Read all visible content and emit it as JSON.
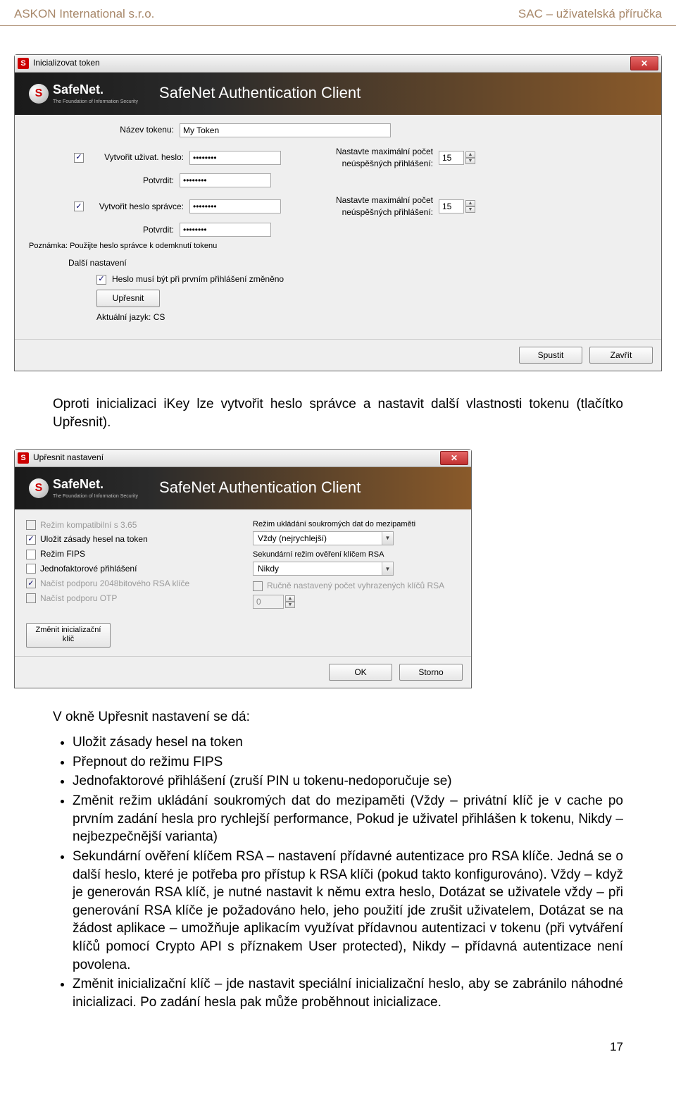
{
  "header": {
    "left": "ASKON International s.r.o.",
    "right": "SAC – uživatelská příručka"
  },
  "dialog1": {
    "title": "Inicializovat token",
    "banner_brand": "SafeNet.",
    "banner_sub": "The Foundation of Information Security",
    "banner_title": "SafeNet Authentication Client",
    "r_token_label": "Název tokenu:",
    "r_token_value": "My Token",
    "chk_user_pw": "Vytvořit uživat. heslo:",
    "user_pw": "••••••••",
    "user_pw_confirm_label": "Potvrdit:",
    "user_pw_confirm": "••••••••",
    "max_fail_label": "Nastavte maximální počet neúspěšných přihlášení:",
    "max_fail_value": "15",
    "chk_admin_pw": "Vytvořit heslo správce:",
    "admin_pw": "••••••••",
    "admin_pw_confirm_label": "Potvrdit:",
    "admin_pw_confirm": "••••••••",
    "max_fail_value2": "15",
    "note": "Poznámka: Použijte heslo správce k odemknutí tokenu",
    "more_settings_label": "Další nastavení",
    "chk_change_first_login": "Heslo musí být při prvním přihlášení změněno",
    "btn_refine": "Upřesnit",
    "lang_label": "Aktuální jazyk: CS",
    "btn_start": "Spustit",
    "btn_close": "Zavřít"
  },
  "para1": "Oproti inicializaci iKey lze vytvořit heslo správce a nastavit další vlastnosti tokenu (tlačítko Upřesnit).",
  "dialog2": {
    "title": "Upřesnit nastavení",
    "left_chk1": "Režim kompatibilní s 3.65",
    "left_chk2": "Uložit zásady hesel na token",
    "left_chk3": "Režim FIPS",
    "left_chk4": "Jednofaktorové přihlášení",
    "left_chk5": "Načíst podporu 2048bitového RSA klíče",
    "left_chk6": "Načíst podporu OTP",
    "right_lbl1": "Režim ukládání soukromých dat do mezipaměti",
    "right_combo1": "Vždy (nejrychlejší)",
    "right_lbl2": "Sekundární režim ověření klíčem RSA",
    "right_combo2": "Nikdy",
    "right_chk1": "Ručně nastavený počet vyhrazených klíčů RSA",
    "right_num": "0",
    "btn_change_init_l1": "Změnit inicializační",
    "btn_change_init_l2": "klíč",
    "btn_ok": "OK",
    "btn_cancel": "Storno"
  },
  "section": {
    "intro": "V okně Upřesnit nastavení se dá:",
    "b1": "Uložit zásady hesel na token",
    "b2": "Přepnout do režimu FIPS",
    "b3": "Jednofaktorové přihlášení (zruší PIN u tokenu-nedoporučuje se)",
    "b4": "Změnit režim ukládání soukromých dat do mezipaměti (Vždy – privátní klíč je v cache po prvním zadání hesla pro rychlejší performance, Pokud je uživatel přihlášen k tokenu, Nikdy – nejbezpečnější varianta)",
    "b5": "Sekundární ověření klíčem RSA – nastavení přídavné autentizace pro RSA klíče. Jedná se o další heslo, které je potřeba pro přístup k RSA klíči (pokud takto konfigurováno). Vždy – když je generován RSA klíč, je nutné nastavit k němu extra heslo, Dotázat se uživatele vždy – při generování RSA klíče je požadováno helo, jeho použití jde zrušit uživatelem, Dotázat se na žádost aplikace – umožňuje aplikacím využívat přídavnou autentizaci v tokenu (při vytváření klíčů pomocí Crypto API s příznakem User protected), Nikdy – přídavná autentizace není povolena.",
    "b6": "Změnit inicializační klíč – jde nastavit speciální inicializační heslo, aby se zabránilo náhodné inicializaci. Po zadání hesla pak může proběhnout inicializace."
  },
  "page_number": "17"
}
